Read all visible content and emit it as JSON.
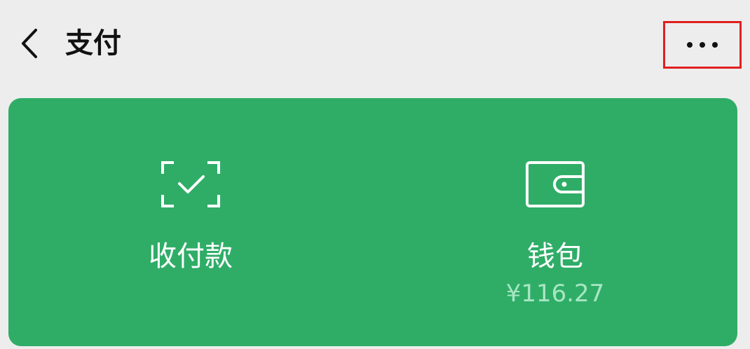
{
  "header": {
    "title": "支付",
    "back_icon": "chevron-left-icon",
    "more_icon": "more-horizontal-icon",
    "highlight_color": "#e02020"
  },
  "card": {
    "background": "#2fad67",
    "tiles": [
      {
        "label": "收付款",
        "icon": "scan-check-icon"
      },
      {
        "label": "钱包",
        "icon": "wallet-icon",
        "balance": "¥116.27"
      }
    ]
  }
}
